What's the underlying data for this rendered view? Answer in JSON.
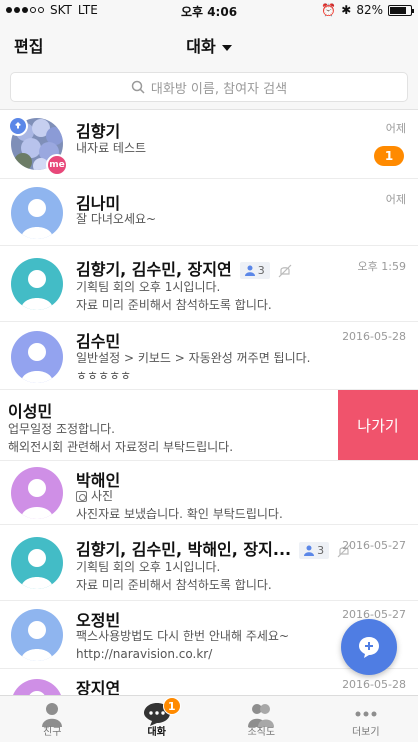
{
  "status_bar": {
    "carrier": "SKT",
    "network": "LTE",
    "time": "오후 4:06",
    "battery_percent": "82%",
    "battery_level": 0.82
  },
  "header": {
    "edit_label": "편집",
    "title": "대화"
  },
  "search": {
    "placeholder": "대화방 이름, 참여자 검색"
  },
  "chats": [
    {
      "name": "김향기",
      "message": "내자료 테스트",
      "time": "어제",
      "unread": "1",
      "pinned": true,
      "me_badge": "me",
      "avatar": "photo"
    },
    {
      "name": "김나미",
      "message": "잘 다녀오세요~",
      "time": "어제",
      "avatar": "blue"
    },
    {
      "name": "김향기, 김수민, 장지연",
      "member_count": "3",
      "muted": true,
      "message_lines": [
        "기획팀 회의 오후 1시입니다.",
        "자료 미리 준비해서 참석하도록 합니다."
      ],
      "time": "오후 1:59",
      "avatar": "teal"
    },
    {
      "name": "김수민",
      "message_lines": [
        "일반설정 > 키보드 > 자동완성 꺼주면 됩니다.",
        "ㅎㅎㅎㅎㅎ"
      ],
      "time": "2016-05-28",
      "avatar": "indigo"
    },
    {
      "name": "이성민",
      "message_lines": [
        "업무일정 조정합니다.",
        "해외전시회 관련해서 자료정리 부탁드립니다."
      ],
      "action_label": "나가기"
    },
    {
      "name": "박해인",
      "attachment": "사진",
      "message": "사진자료 보냈습니다. 확인 부탁드립니다.",
      "avatar": "purple"
    },
    {
      "name": "김향기, 김수민, 박해인, 장지...",
      "member_count": "3",
      "muted": true,
      "message_lines": [
        "기획팀 회의 오후 1시입니다.",
        "자료 미리 준비해서 참석하도록 합니다."
      ],
      "time": "2016-05-27",
      "avatar": "teal"
    },
    {
      "name": "오정빈",
      "message_lines": [
        "팩스사용방법도 다시 한번 안내해 주세요~",
        "http://naravision.co.kr/"
      ],
      "time": "2016-05-27",
      "avatar": "blue"
    },
    {
      "name": "장지연",
      "time": "2016-05-28",
      "avatar": "purple"
    }
  ],
  "tabs": [
    {
      "label": "친구",
      "icon": "person-icon"
    },
    {
      "label": "대화",
      "icon": "chat-bubble-icon",
      "badge": "1",
      "active": true
    },
    {
      "label": "조직도",
      "icon": "people-icon"
    },
    {
      "label": "더보기",
      "icon": "more-dots-icon"
    }
  ],
  "colors": {
    "accent_blue": "#4f7de3",
    "unread_orange": "#ff8a00",
    "leave_red": "#f0536c",
    "me_pink": "#e8487a"
  }
}
